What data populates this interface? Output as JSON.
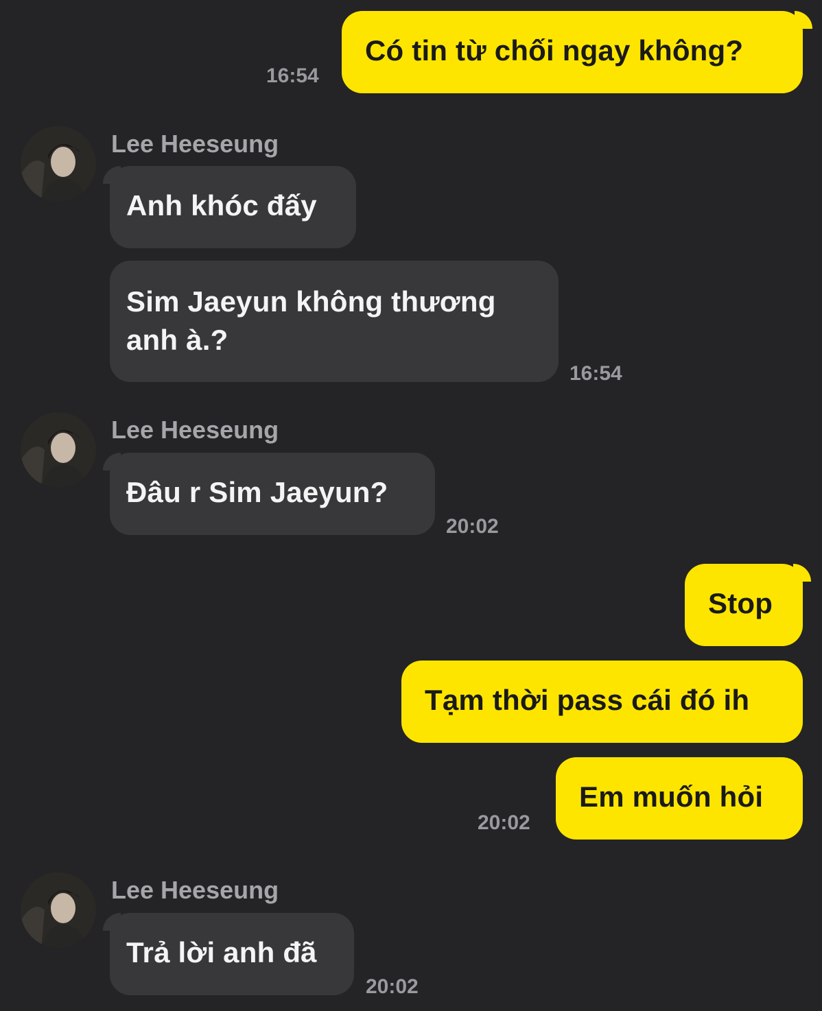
{
  "colors": {
    "background": "#242427",
    "outgoing_bubble": "#FEE500",
    "incoming_bubble": "#38383B",
    "timestamp": "#9a9a9e",
    "sender_name": "#a6a6aa"
  },
  "messages": [
    {
      "side": "out",
      "text": "Có tin từ chối ngay không?",
      "time": "16:54"
    },
    {
      "side": "in",
      "sender": "Lee Heeseung",
      "avatar": "profile-photo",
      "bubbles": [
        "Anh khóc đấy",
        "Sim Jaeyun không thương anh à.?"
      ],
      "time": "16:54"
    },
    {
      "side": "in",
      "sender": "Lee Heeseung",
      "avatar": "profile-photo",
      "bubbles": [
        "Đâu r Sim Jaeyun?"
      ],
      "time": "20:02"
    },
    {
      "side": "out",
      "bubbles": [
        "Stop",
        "Tạm thời pass cái đó ih",
        "Em muốn hỏi"
      ],
      "time": "20:02"
    },
    {
      "side": "in",
      "sender": "Lee Heeseung",
      "avatar": "profile-photo",
      "bubbles": [
        "Trả lời anh đã"
      ],
      "time": "20:02"
    }
  ]
}
